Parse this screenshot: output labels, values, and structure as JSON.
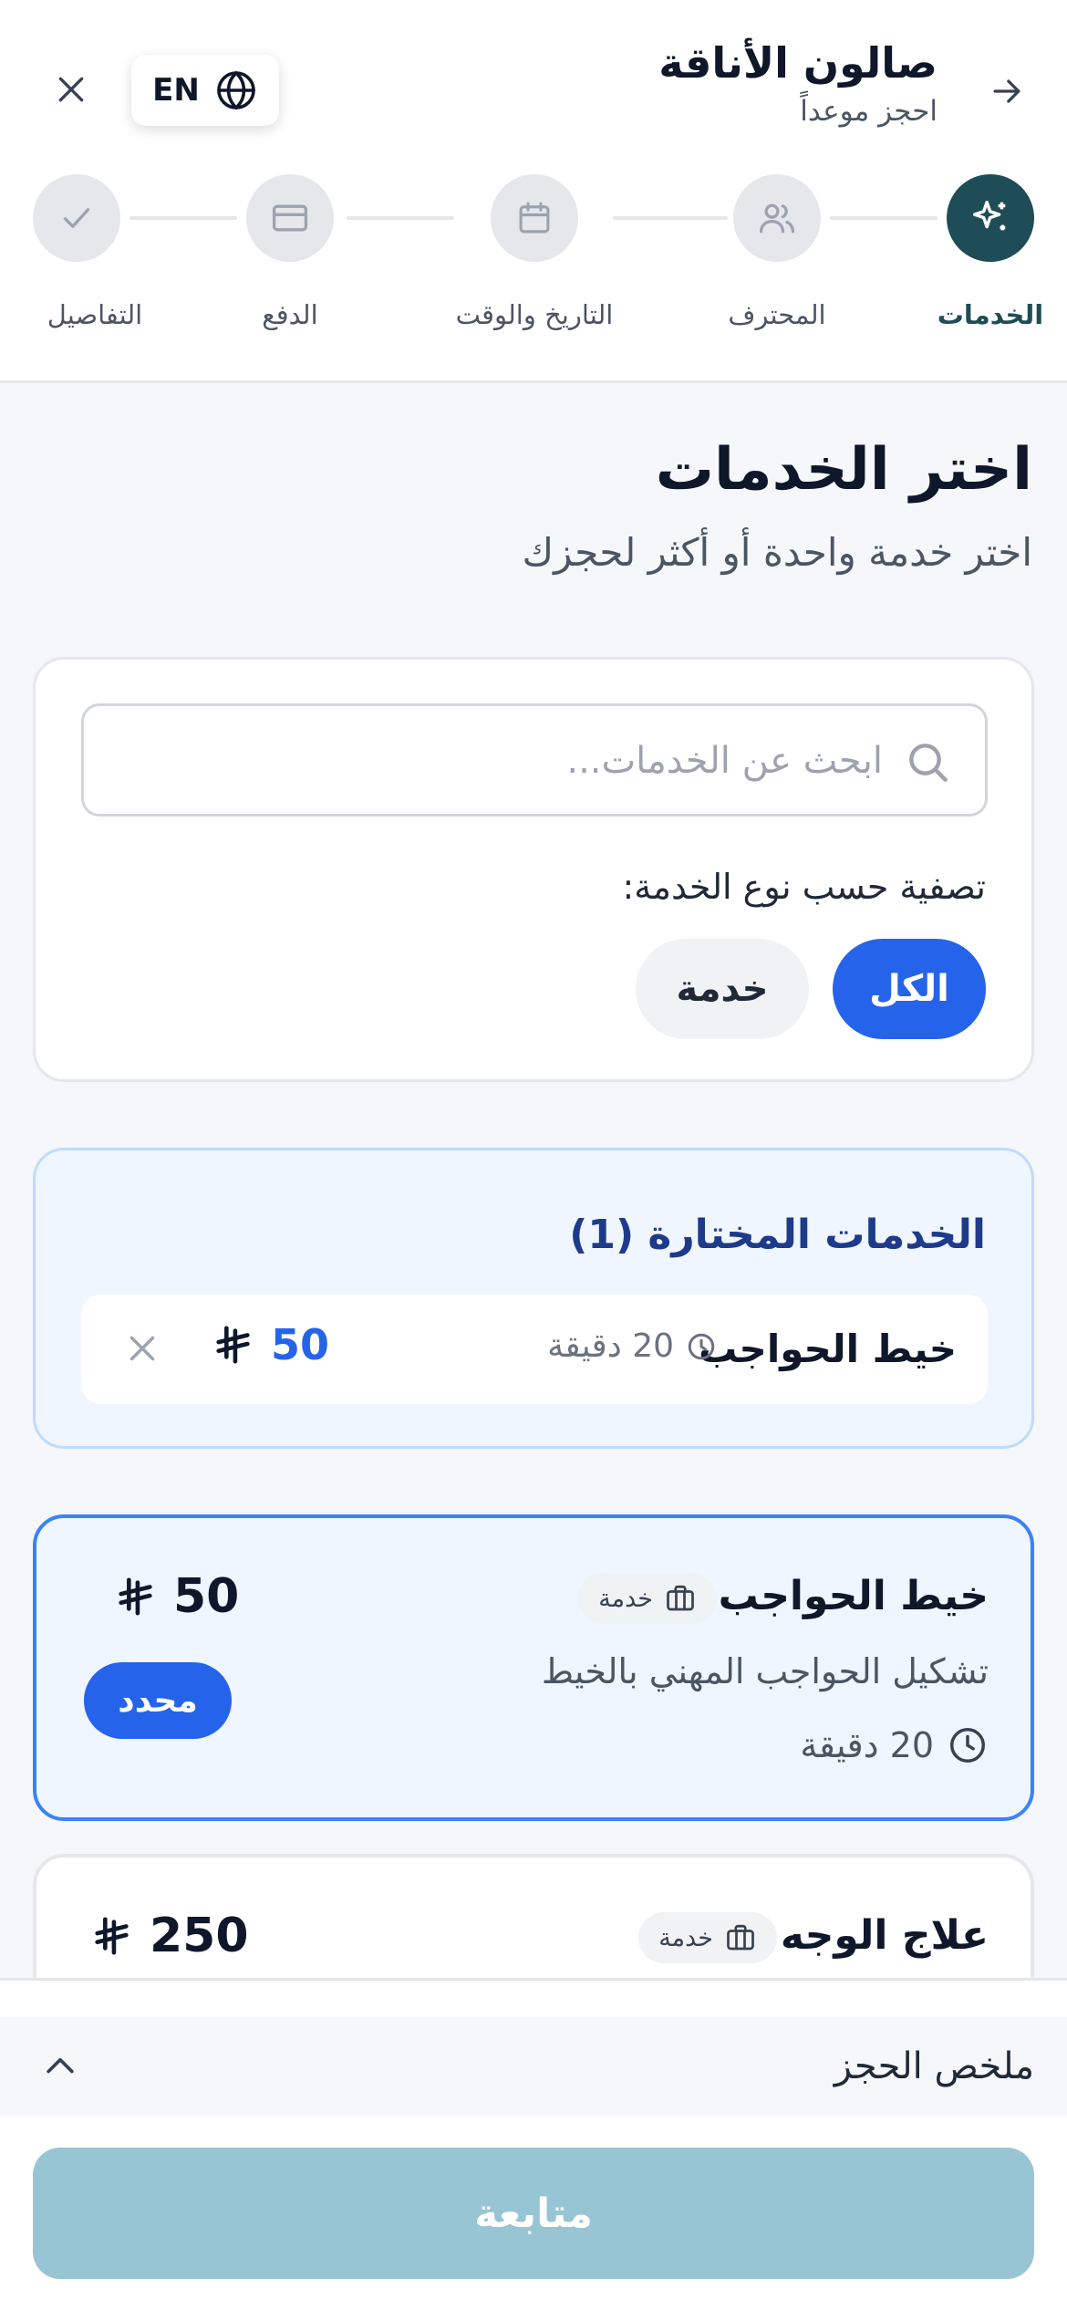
{
  "header": {
    "salon_name": "صالون الأناقة",
    "subtitle": "احجز موعداً",
    "language_label": "EN",
    "back_icon": "arrow-right-icon",
    "close_icon": "close-icon"
  },
  "steps": [
    {
      "label": "الخدمات",
      "icon": "sparkles-icon",
      "state": "active"
    },
    {
      "label": "المحترف",
      "icon": "users-icon",
      "state": "pending"
    },
    {
      "label": "التاريخ والوقت",
      "icon": "calendar-icon",
      "state": "pending"
    },
    {
      "label": "الدفع",
      "icon": "credit-card-icon",
      "state": "pending"
    },
    {
      "label": "التفاصيل",
      "icon": "check-icon",
      "state": "pending"
    }
  ],
  "page": {
    "title": "اختر الخدمات",
    "subtitle": "اختر خدمة واحدة أو أكثر لحجزك"
  },
  "search": {
    "placeholder": "ابحث عن الخدمات...",
    "value": ""
  },
  "filter": {
    "label": "تصفية حسب نوع الخدمة:",
    "options": [
      "الكل",
      "خدمة"
    ],
    "selected": "الكل"
  },
  "selected_services": {
    "title": "الخدمات المختارة (1)",
    "items": [
      {
        "name": "خيط الحواجب",
        "duration": "20 دقيقة",
        "price": "50"
      }
    ]
  },
  "services": [
    {
      "name": "خيط الحواجب",
      "badge": "خدمة",
      "description": "تشكيل الحواجب المهني بالخيط",
      "duration": "20 دقيقة",
      "price": "50",
      "status_label": "محدد",
      "selected": true
    },
    {
      "name": "علاج الوجه",
      "badge": "خدمة",
      "price": "250",
      "selected": false
    }
  ],
  "footer": {
    "summary_label": "ملخص الحجز",
    "continue_label": "متابعة"
  },
  "colors": {
    "primary": "#1e4d57",
    "accent": "#2563eb",
    "continue_disabled": "#98c5d4",
    "selected_bg": "#eff6ff"
  }
}
